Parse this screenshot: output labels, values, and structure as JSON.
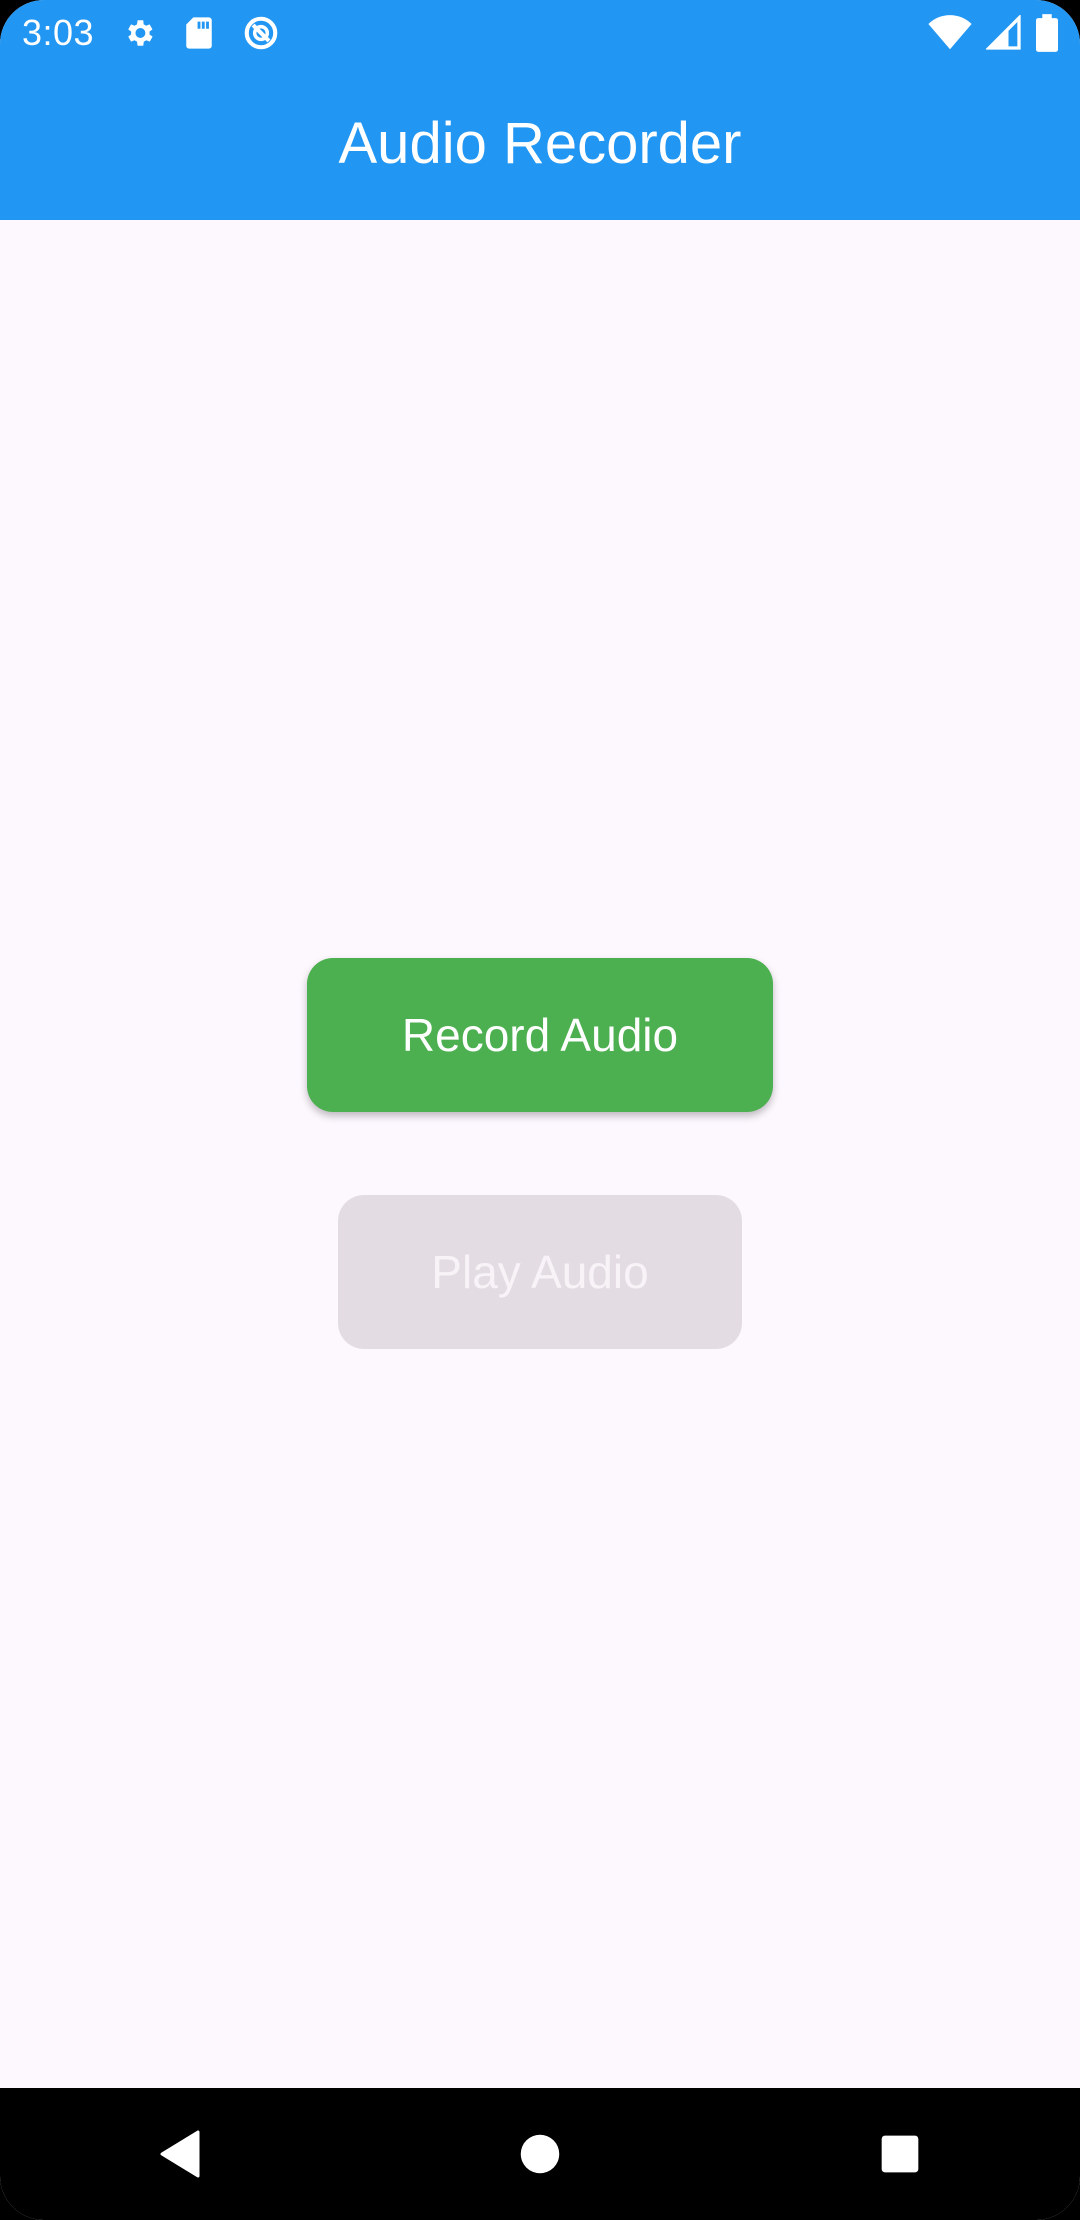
{
  "status_bar": {
    "time": "3:03",
    "icons_left": [
      "gear-icon",
      "sd-card-icon",
      "data-saver-icon"
    ],
    "icons_right": [
      "wifi-icon",
      "cell-signal-icon",
      "battery-icon"
    ],
    "color": "#2196F3"
  },
  "app_bar": {
    "title": "Audio Recorder",
    "color": "#2196F3"
  },
  "main": {
    "record_button": {
      "label": "Record Audio",
      "color": "#4CAF50",
      "enabled": true
    },
    "play_button": {
      "label": "Play Audio",
      "color": "#E3DDE3",
      "enabled": false
    }
  },
  "nav_bar": {
    "items": [
      "back-icon",
      "home-icon",
      "recents-icon"
    ]
  }
}
